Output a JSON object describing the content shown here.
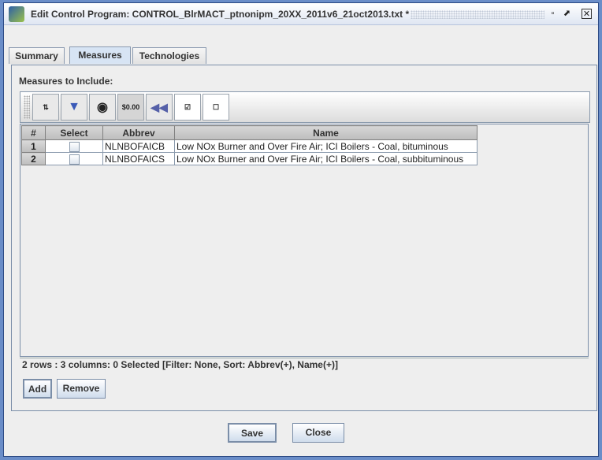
{
  "window": {
    "title": "Edit Control Program: CONTROL_BlrMACT_ptnonipm_20XX_2011v6_21oct2013.txt *",
    "controls": {
      "minimize": "▫",
      "maximize": "⬈",
      "close": "✕"
    }
  },
  "tabs": [
    {
      "label": "Summary",
      "active": false
    },
    {
      "label": "Measures",
      "active": true
    },
    {
      "label": "Technologies",
      "active": false
    }
  ],
  "measures": {
    "section_label": "Measures to Include:",
    "toolbar": [
      {
        "icon": "sort-icon"
      },
      {
        "icon": "filter-icon"
      },
      {
        "icon": "view-icon"
      },
      {
        "icon": "format-icon",
        "text": "$0.00"
      },
      {
        "icon": "reset-icon"
      },
      {
        "icon": "select-all-icon"
      },
      {
        "icon": "clear-selection-icon"
      }
    ],
    "columns": [
      "#",
      "Select",
      "Abbrev",
      "Name"
    ],
    "rows": [
      {
        "num": "1",
        "selected": false,
        "abbrev": "NLNBOFAICB",
        "name": "Low NOx Burner and Over Fire Air; ICI Boilers - Coal, bituminous"
      },
      {
        "num": "2",
        "selected": false,
        "abbrev": "NLNBOFAICS",
        "name": "Low NOx Burner and Over Fire Air; ICI Boilers - Coal, subbituminous"
      }
    ],
    "status": "2 rows : 3 columns: 0 Selected [Filter: None, Sort: Abbrev(+), Name(+)]",
    "add_label": "Add",
    "remove_label": "Remove"
  },
  "footer": {
    "save_label": "Save",
    "close_label": "Close"
  }
}
